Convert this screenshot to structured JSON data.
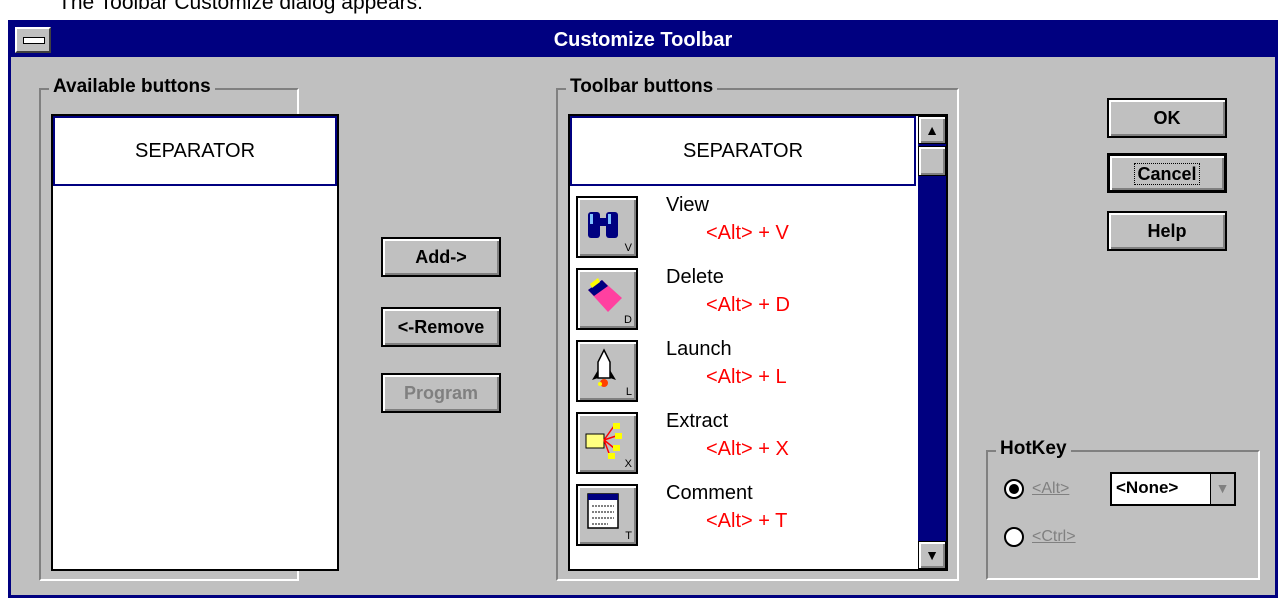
{
  "caption": "The Toolbar Customize dialog appears:",
  "dialog": {
    "title": "Customize Toolbar",
    "available": {
      "label": "Available buttons",
      "items": [
        "SEPARATOR"
      ]
    },
    "toolbar": {
      "label": "Toolbar buttons",
      "separator": "SEPARATOR",
      "items": [
        {
          "name": "View",
          "hotkey": "<Alt> + V",
          "key": "V",
          "icon": "binoculars-icon"
        },
        {
          "name": "Delete",
          "hotkey": "<Alt> + D",
          "key": "D",
          "icon": "eraser-icon"
        },
        {
          "name": "Launch",
          "hotkey": "<Alt> + L",
          "key": "L",
          "icon": "rocket-icon"
        },
        {
          "name": "Extract",
          "hotkey": "<Alt> + X",
          "key": "X",
          "icon": "folder-tree-icon"
        },
        {
          "name": "Comment",
          "hotkey": "<Alt> + T",
          "key": "T",
          "icon": "notepad-icon"
        }
      ]
    },
    "buttons": {
      "add": "Add->",
      "remove": "<-Remove",
      "program": "Program",
      "ok": "OK",
      "cancel": "Cancel",
      "help": "Help"
    },
    "hotkey": {
      "label": "HotKey",
      "alt_label": "<Alt>",
      "ctrl_label": "<Ctrl>",
      "selected": "<Alt>",
      "combo_value": "<None>"
    }
  }
}
